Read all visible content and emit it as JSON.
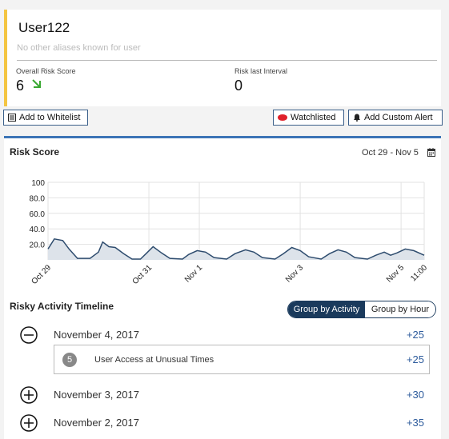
{
  "user": {
    "name": "User122",
    "aliases": "No other aliases known for user",
    "overall_risk_label": "Overall Risk Score",
    "overall_risk_value": "6",
    "risk_interval_label": "Risk last Interval",
    "risk_interval_value": "0"
  },
  "actions": {
    "whitelist": "Add to Whitelist",
    "watchlisted": "Watchlisted",
    "custom_alert": "Add Custom Alert"
  },
  "risk_panel": {
    "title": "Risk Score",
    "date_range": "Oct 29 - Nov 5"
  },
  "timeline": {
    "title": "Risky Activity Timeline",
    "group_activity": "Group by Activity",
    "group_hour": "Group by Hour",
    "days": [
      {
        "date": "November 4, 2017",
        "count": "+25",
        "expanded": true
      },
      {
        "date": "November 3, 2017",
        "count": "+30",
        "expanded": false
      },
      {
        "date": "November 2, 2017",
        "count": "+35",
        "expanded": false
      }
    ],
    "activity": {
      "badge": "5",
      "label": "User Access at Unusual Times",
      "count": "+25"
    }
  },
  "colors": {
    "accent_bar": "#f4c542",
    "panel_border": "#3c74b6",
    "toggle_active": "#1a3a5c",
    "count_text": "#2d5b9c",
    "watchlist_dot": "#e0202a",
    "trend_arrow": "#3aa832",
    "chart_line": "#2e4c6e",
    "chart_fill": "#dde3ea"
  },
  "icons": {
    "whitelist": "list-icon",
    "watchlist": "red-dot-icon",
    "alert": "bell-icon",
    "trend": "arrow-down-right-icon",
    "calendar": "calendar-icon",
    "expanded": "minus-circle-icon",
    "collapsed": "plus-circle-icon"
  },
  "chart_data": {
    "type": "area",
    "title": "Risk Score",
    "ylim": [
      0,
      100
    ],
    "y_ticks": [
      "100",
      "80.0",
      "60.0",
      "40.0",
      "20.0"
    ],
    "x_ticks": [
      {
        "label": "Oct 29",
        "t": 0
      },
      {
        "label": "Oct 31",
        "t": 48
      },
      {
        "label": "Nov 1",
        "t": 72
      },
      {
        "label": "Nov 3",
        "t": 120
      },
      {
        "label": "Nov 5",
        "t": 168
      },
      {
        "label": "11:00",
        "t": 179
      }
    ],
    "t_max": 179,
    "grid": true,
    "series": [
      {
        "values": [
          {
            "t": 0,
            "y": 14
          },
          {
            "t": 3,
            "y": 27
          },
          {
            "t": 7,
            "y": 25
          },
          {
            "t": 10,
            "y": 14
          },
          {
            "t": 14,
            "y": 2
          },
          {
            "t": 20,
            "y": 2
          },
          {
            "t": 24,
            "y": 10
          },
          {
            "t": 26,
            "y": 23
          },
          {
            "t": 29,
            "y": 17
          },
          {
            "t": 32,
            "y": 16
          },
          {
            "t": 36,
            "y": 8
          },
          {
            "t": 40,
            "y": 1
          },
          {
            "t": 44,
            "y": 1
          },
          {
            "t": 47,
            "y": 9
          },
          {
            "t": 50,
            "y": 17
          },
          {
            "t": 54,
            "y": 9
          },
          {
            "t": 58,
            "y": 2
          },
          {
            "t": 64,
            "y": 1
          },
          {
            "t": 67,
            "y": 7
          },
          {
            "t": 71,
            "y": 12
          },
          {
            "t": 75,
            "y": 10
          },
          {
            "t": 79,
            "y": 3
          },
          {
            "t": 85,
            "y": 1
          },
          {
            "t": 89,
            "y": 8
          },
          {
            "t": 94,
            "y": 13
          },
          {
            "t": 98,
            "y": 10
          },
          {
            "t": 102,
            "y": 3
          },
          {
            "t": 108,
            "y": 1
          },
          {
            "t": 112,
            "y": 8
          },
          {
            "t": 116,
            "y": 16
          },
          {
            "t": 120,
            "y": 12
          },
          {
            "t": 124,
            "y": 4
          },
          {
            "t": 130,
            "y": 1
          },
          {
            "t": 134,
            "y": 8
          },
          {
            "t": 138,
            "y": 13
          },
          {
            "t": 142,
            "y": 10
          },
          {
            "t": 146,
            "y": 3
          },
          {
            "t": 152,
            "y": 1
          },
          {
            "t": 156,
            "y": 6
          },
          {
            "t": 160,
            "y": 10
          },
          {
            "t": 163,
            "y": 6
          },
          {
            "t": 166,
            "y": 9
          },
          {
            "t": 170,
            "y": 14
          },
          {
            "t": 174,
            "y": 12
          },
          {
            "t": 179,
            "y": 6
          }
        ]
      }
    ]
  }
}
